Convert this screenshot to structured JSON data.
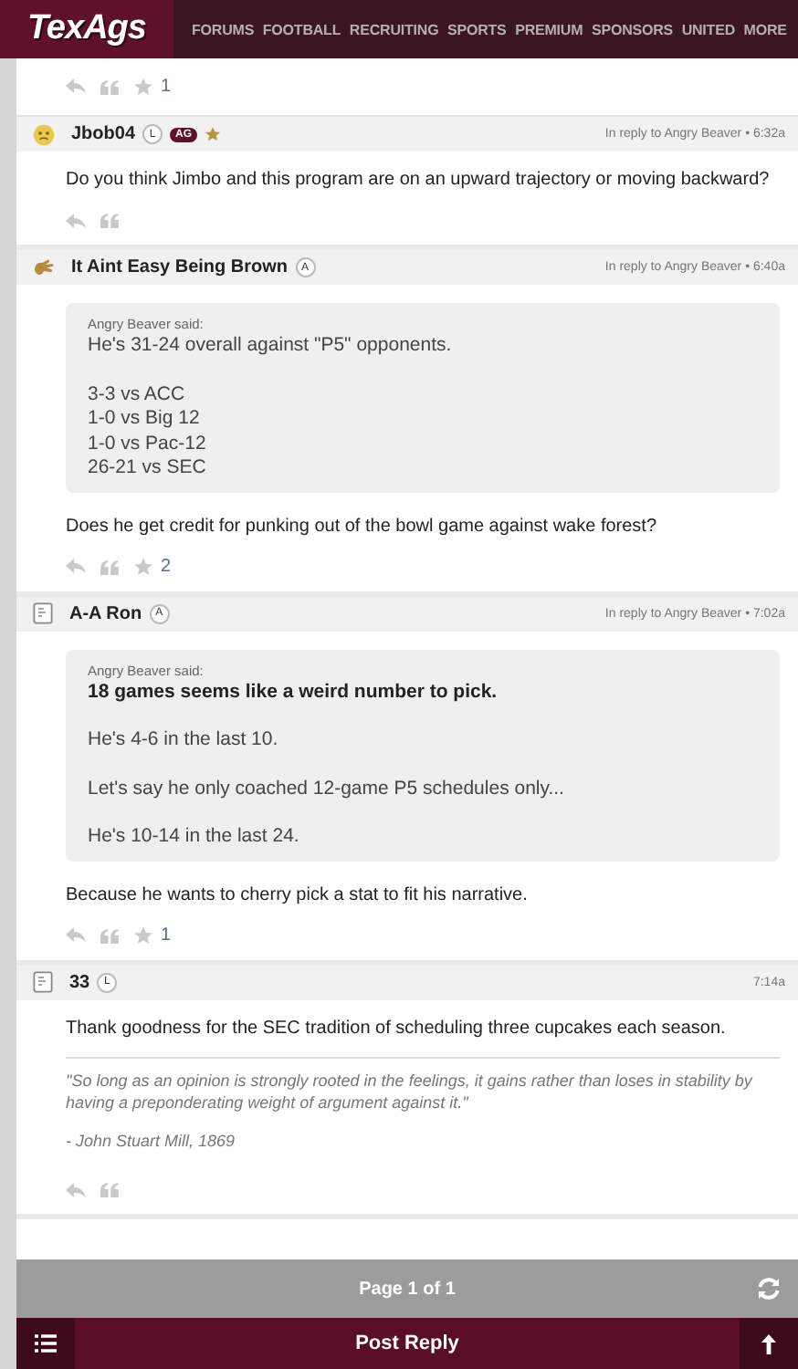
{
  "header": {
    "logo": "TexAgs",
    "nav": [
      "FORUMS",
      "FOOTBALL",
      "RECRUITING",
      "SPORTS",
      "PREMIUM",
      "SPONSORS",
      "UNITED",
      "MORE"
    ]
  },
  "previous_post_actions": {
    "likes": "1"
  },
  "posts": [
    {
      "author": "Jbob04",
      "avatar": {
        "kind": "emoji"
      },
      "badges": [
        {
          "kind": "circle",
          "text": "L"
        },
        {
          "kind": "pill",
          "text": "AG"
        },
        {
          "kind": "star"
        }
      ],
      "meta": "In reply to Angry Beaver • 6:32a",
      "body": "Do you think Jimbo and this program are on an upward trajectory or moving backward?"
    },
    {
      "author": "It Aint Easy Being Brown",
      "avatar": {
        "kind": "custom"
      },
      "badges": [
        {
          "kind": "circle",
          "text": "A"
        }
      ],
      "meta": "In reply to Angry Beaver • 6:40a",
      "quote": {
        "attribution": "Angry Beaver said:",
        "paragraphs": [
          {
            "bold": false,
            "lines": [
              "He's 31-24 overall against \"P5\" opponents."
            ]
          },
          {
            "bold": false,
            "lines": [
              "3-3 vs ACC",
              "1-0 vs Big 12",
              "1-0 vs Pac-12",
              "26-21 vs SEC"
            ]
          }
        ]
      },
      "body": "Does he get credit for punking out of the bowl game against wake forest?",
      "likes": "2"
    },
    {
      "author": "A-A Ron",
      "avatar": {
        "kind": "default"
      },
      "badges": [
        {
          "kind": "circle",
          "text": "A"
        }
      ],
      "meta": "In reply to Angry Beaver • 7:02a",
      "quote": {
        "attribution": "Angry Beaver said:",
        "paragraphs": [
          {
            "bold": true,
            "lines": [
              "18 games seems like a weird number to pick."
            ]
          },
          {
            "bold": false,
            "lines": [
              "He's 4-6 in the last 10."
            ]
          },
          {
            "bold": false,
            "lines": [
              "Let's say he only coached 12-game P5 schedules only..."
            ]
          },
          {
            "bold": false,
            "lines": [
              "He's 10-14 in the last 24."
            ]
          }
        ]
      },
      "body": "Because he wants to cherry pick a stat to fit his narrative.",
      "likes": "1"
    },
    {
      "author": "33",
      "avatar": {
        "kind": "default"
      },
      "badges": [
        {
          "kind": "circle",
          "text": "L"
        }
      ],
      "meta": "7:14a",
      "body": "Thank goodness for the SEC tradition of scheduling three cupcakes each season.",
      "signature": [
        "\"So long as an opinion is strongly rooted in the feelings, it gains rather than loses in stability by having a preponderating weight of argument against it.\"",
        "- John Stuart Mill, 1869"
      ]
    }
  ],
  "pager": {
    "label": "Page 1 of 1"
  },
  "bottom_bar": {
    "label": "Post Reply"
  }
}
